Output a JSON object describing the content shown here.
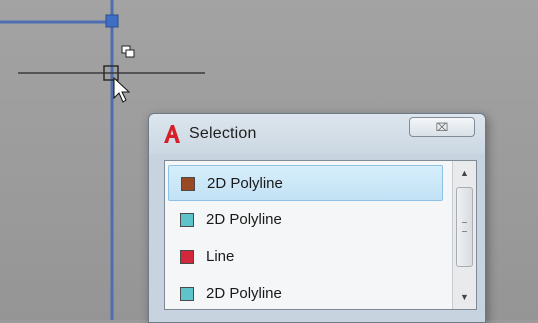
{
  "dialog": {
    "title": "Selection",
    "close_label": "⌧",
    "app_icon": "autocad-a-icon"
  },
  "list": {
    "items": [
      {
        "label": "2D Polyline",
        "color": "#9a4a22",
        "selected": true
      },
      {
        "label": "2D Polyline",
        "color": "#5fc3cc",
        "selected": false
      },
      {
        "label": "Line",
        "color": "#d2283c",
        "selected": false
      },
      {
        "label": "2D Polyline",
        "color": "#5fc3cc",
        "selected": false
      }
    ]
  },
  "scrollbar": {
    "up_icon": "▲",
    "down_icon": "▼"
  },
  "colors": {
    "drawing_background": "#9c9c9c",
    "polyline_blue": "#4d6fb2",
    "crosshair": "#3b3b3b",
    "grip": "#3f6ec4"
  }
}
